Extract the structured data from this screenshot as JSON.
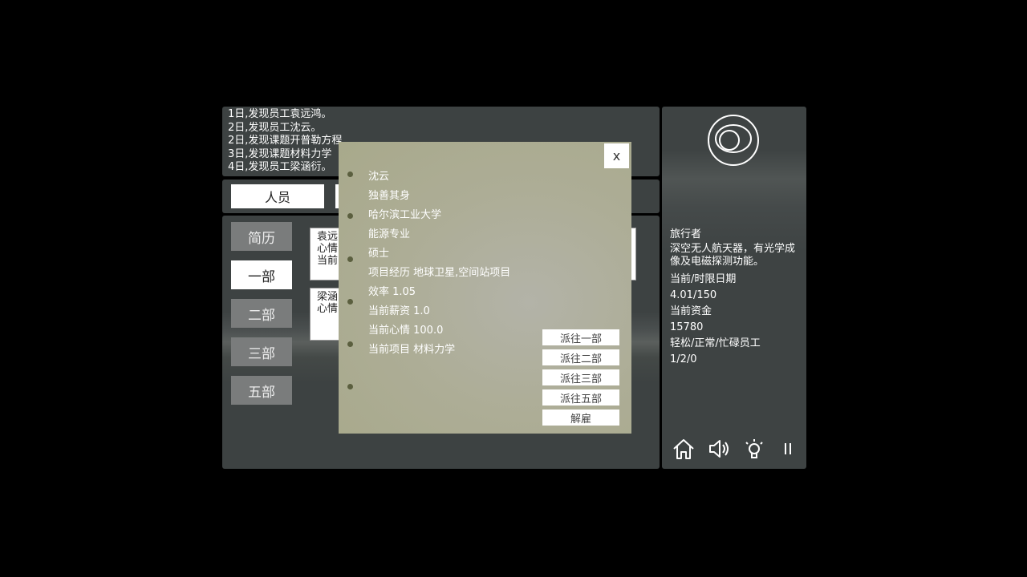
{
  "log": {
    "lines": [
      "1日,发现员工袁远鸿。",
      "2日,发现员工沈云。",
      "2日,发现课题开普勒方程",
      "3日,发现课题材料力学",
      "4日,发现员工梁涵衍。"
    ]
  },
  "tabs": {
    "personnel": "人员"
  },
  "departments": {
    "resume": "简历",
    "dept1": "一部",
    "dept2": "二部",
    "dept3": "三部",
    "dept5": "五部"
  },
  "cards": [
    {
      "line1": "袁远",
      "line2": "心情",
      "line3": "当前"
    },
    {
      "line1": "梁涵",
      "line2": "心情"
    }
  ],
  "side": {
    "player_name": "旅行者",
    "description": "深空无人航天器，有光学成像及电磁探测功能。",
    "date_label": "当前/时限日期",
    "date_value": "4.01/150",
    "funds_label": "当前资金",
    "funds_value": "15780",
    "staff_label": "轻松/正常/忙碌员工",
    "staff_value": "1/2/0"
  },
  "icons": {
    "logo": "orbit-logo-icon",
    "home": "home-icon",
    "sound": "speaker-icon",
    "hint": "lightbulb-icon",
    "pause": "pause-icon"
  },
  "modal": {
    "close_label": "x",
    "name": "沈云",
    "trait": "独善其身",
    "school": "哈尔滨工业大学",
    "major": "能源专业",
    "degree": "硕士",
    "experience": "项目经历 地球卫星,空间站项目",
    "efficiency": "效率 1.05",
    "salary": "当前薪资 1.0",
    "mood": "当前心情 100.0",
    "project": "当前项目 材料力学",
    "actions": {
      "send1": "派往一部",
      "send2": "派往二部",
      "send3": "派往三部",
      "send5": "派往五部",
      "fire": "解雇"
    }
  },
  "colors": {
    "panel": "#3d4242",
    "modal": "#adad96",
    "dot": "#5b5f3f"
  }
}
